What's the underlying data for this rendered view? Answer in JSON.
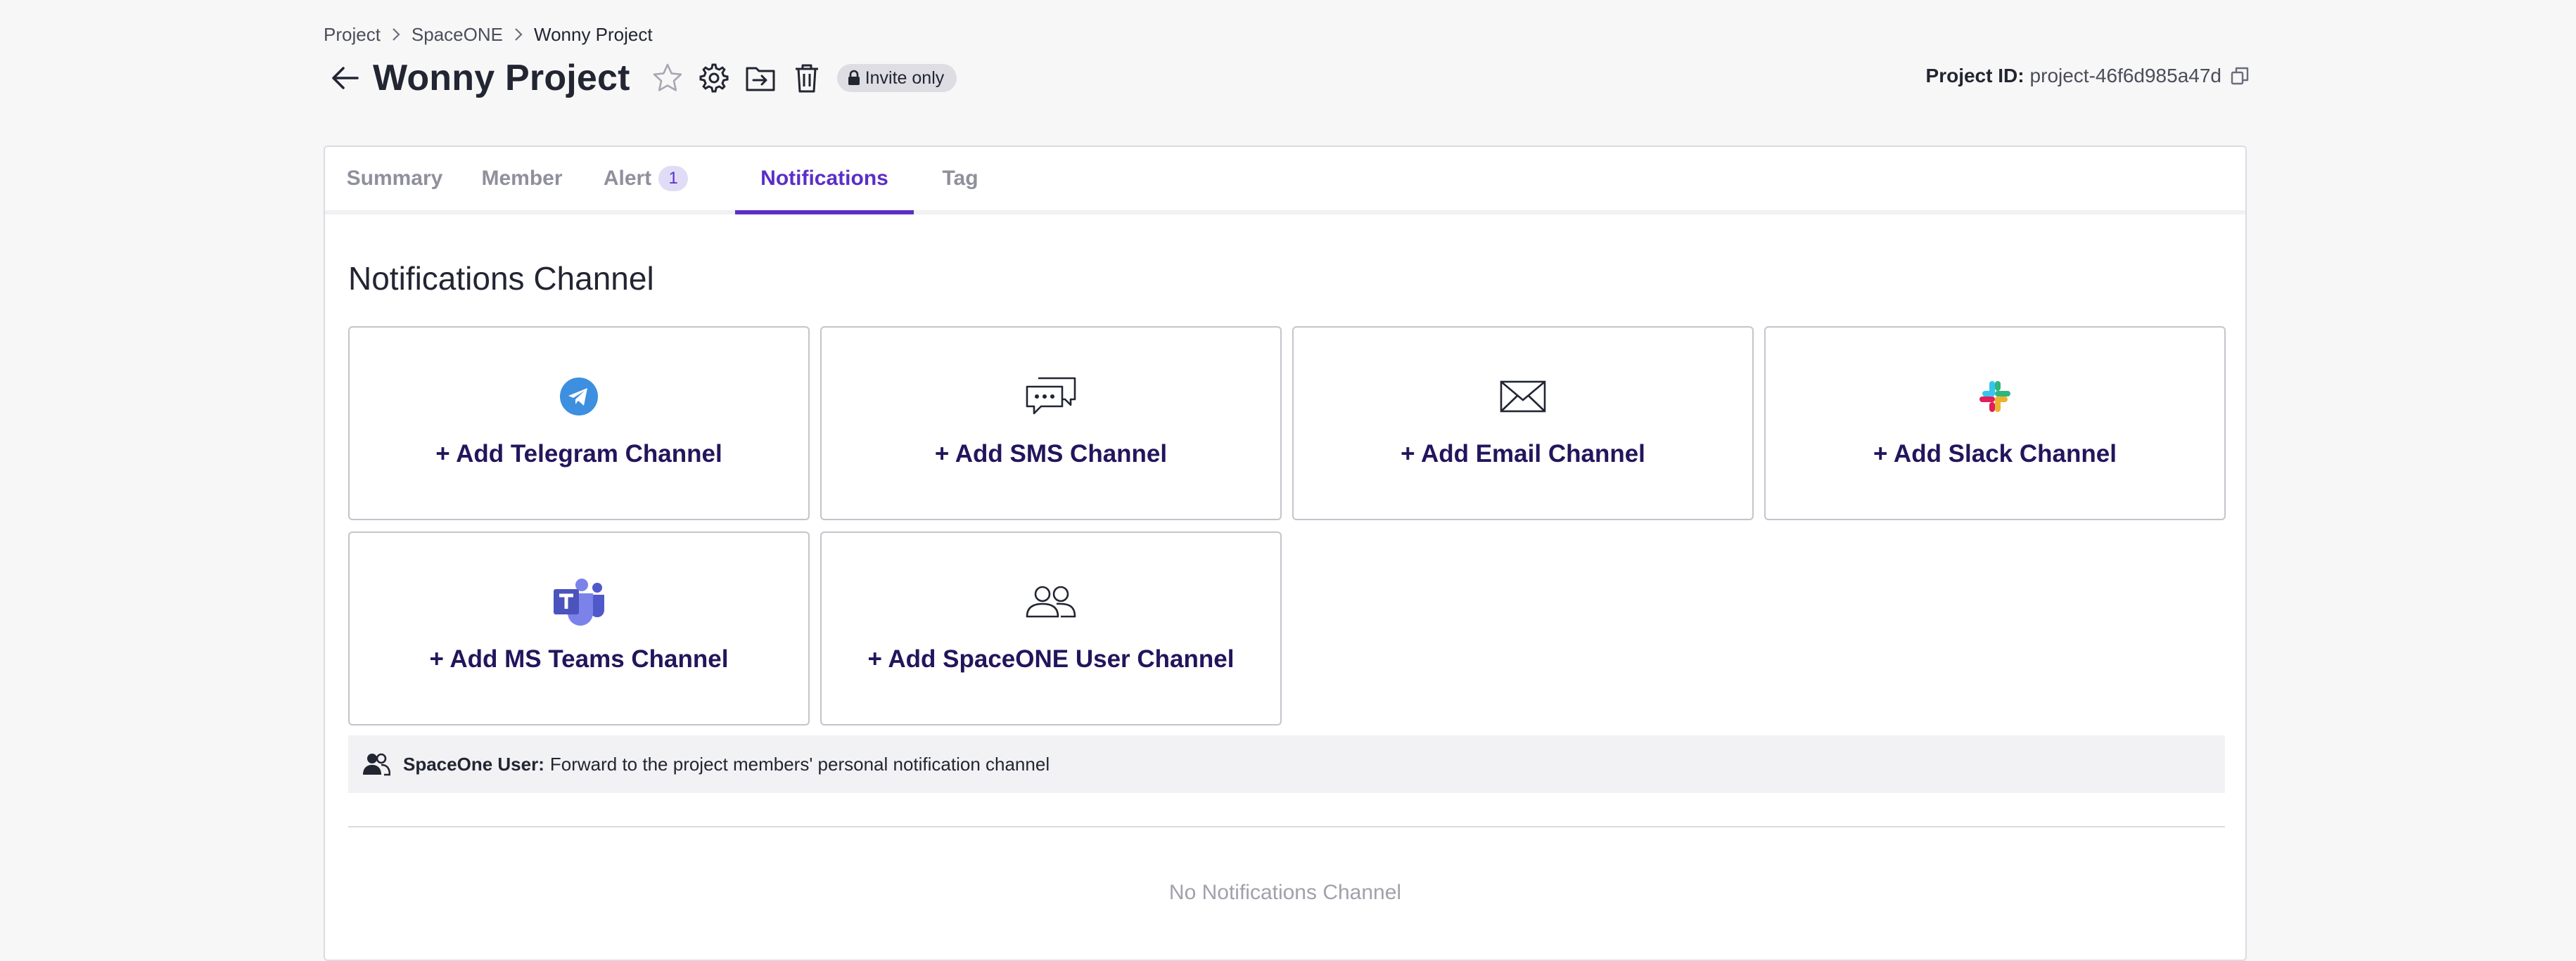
{
  "breadcrumb": {
    "items": [
      "Project",
      "SpaceONE",
      "Wonny Project"
    ]
  },
  "header": {
    "title": "Wonny Project",
    "visibility_badge": "Invite only",
    "project_id_label": "Project ID:",
    "project_id_value": "project-46f6d985a47d"
  },
  "tabs": [
    {
      "label": "Summary",
      "active": false
    },
    {
      "label": "Member",
      "active": false
    },
    {
      "label": "Alert",
      "count": "1",
      "active": false
    },
    {
      "label": "Notifications",
      "active": true
    },
    {
      "label": "Tag",
      "active": false
    }
  ],
  "notifications": {
    "section_title": "Notifications Channel",
    "channels": [
      {
        "label": "+ Add Telegram Channel",
        "icon": "telegram-icon"
      },
      {
        "label": "+ Add SMS Channel",
        "icon": "sms-chat-icon"
      },
      {
        "label": "+ Add Email Channel",
        "icon": "email-envelope-icon"
      },
      {
        "label": "+ Add Slack Channel",
        "icon": "slack-icon"
      },
      {
        "label": "+ Add MS Teams Channel",
        "icon": "ms-teams-icon"
      },
      {
        "label": "+ Add SpaceONE User Channel",
        "icon": "users-icon"
      }
    ],
    "info": {
      "strong": "SpaceOne User:",
      "text": "Forward to the project members' personal notification channel"
    },
    "empty_message": "No Notifications Channel"
  },
  "colors": {
    "accent": "#5b2ec8",
    "card_label": "#23155c",
    "background": "#f7f7f7",
    "telegram": "#3d8fe0",
    "teams": "#5059c9"
  }
}
